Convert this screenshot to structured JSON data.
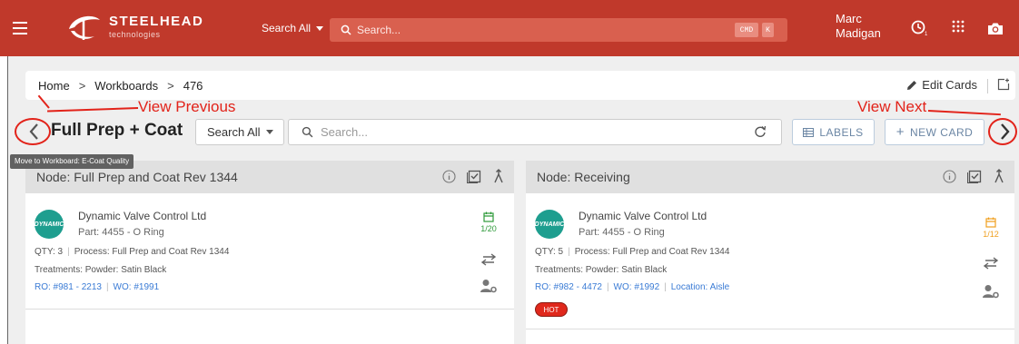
{
  "topbar": {
    "brand_name": "STEELHEAD",
    "brand_sub": "technologies",
    "search_scope": "Search All",
    "search_placeholder": "Search...",
    "kbd_cmd": "CMD",
    "kbd_k": "K",
    "user_first": "Marc",
    "user_last": "Madigan",
    "icons": [
      "menu-icon",
      "history-icon",
      "apps-grid-icon",
      "camera-icon"
    ]
  },
  "breadcrumb": {
    "items": [
      "Home",
      "Workboards",
      "476"
    ],
    "separator": ">",
    "edit_cards": "Edit Cards"
  },
  "annotations": {
    "prev": "View Previous",
    "next": "View Next",
    "color": "#e2231a"
  },
  "board": {
    "title": "Full Prep + Coat",
    "scope": "Search All",
    "search_placeholder": "Search...",
    "labels_btn": "LABELS",
    "new_card_btn": "NEW CARD",
    "tooltip": "Move to Workboard: E-Coat Quality"
  },
  "columns": [
    {
      "header": "Node: Full Prep and Coat Rev 1344",
      "card": {
        "logo_text": "DYNAMIC",
        "customer": "Dynamic Valve Control Ltd",
        "part": "Part: 4455 - O Ring",
        "qty": "QTY: 3",
        "process": "Process: Full Prep and Coat Rev 1344",
        "treatments": "Treatments: Powder: Satin Black",
        "ro": "RO: #981 - 2213",
        "wo": "WO: #1991",
        "location": "",
        "date_count": "1/20",
        "date_color": "#2e9a3a",
        "tag": ""
      }
    },
    {
      "header": "Node: Receiving",
      "card": {
        "logo_text": "DYNAMIC",
        "customer": "Dynamic Valve Control Ltd",
        "part": "Part: 4455 - O Ring",
        "qty": "QTY: 5",
        "process": "Process: Full Prep and Coat Rev 1344",
        "treatments": "Treatments: Powder: Satin Black",
        "ro": "RO: #982 - 4472",
        "wo": "WO: #1992",
        "location": "Location: Aisle",
        "date_count": "1/12",
        "date_color": "#f0a020",
        "tag": "HOT"
      }
    }
  ],
  "colors": {
    "brand": "#c0392b",
    "link": "#3a7bd5",
    "hot": "#e0281c"
  }
}
